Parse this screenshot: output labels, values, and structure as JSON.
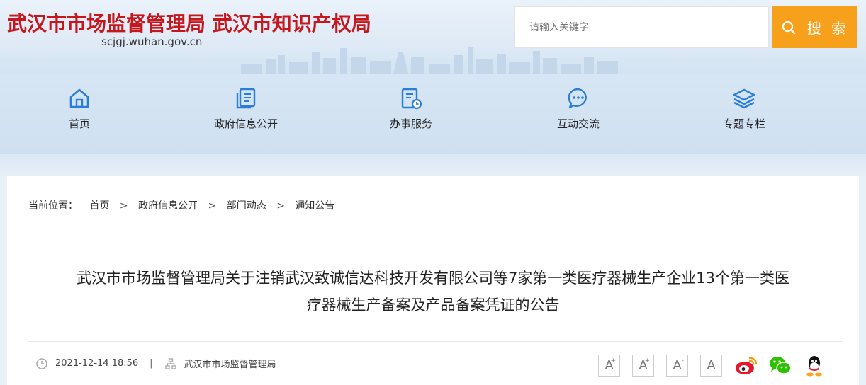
{
  "header": {
    "title": "武汉市市场监督管理局 武汉市知识产权局",
    "domain": "scjgj.wuhan.gov.cn",
    "search_placeholder": "请输入关键字",
    "search_button": "搜 索"
  },
  "nav": {
    "items": [
      {
        "label": "首页",
        "icon": "home-icon"
      },
      {
        "label": "政府信息公开",
        "icon": "document-icon"
      },
      {
        "label": "办事服务",
        "icon": "service-icon"
      },
      {
        "label": "互动交流",
        "icon": "chat-icon"
      },
      {
        "label": "专题专栏",
        "icon": "layers-icon"
      }
    ]
  },
  "breadcrumb": {
    "label": "当前位置：",
    "items": [
      "首页",
      "政府信息公开",
      "部门动态",
      "通知公告"
    ],
    "separator": ">"
  },
  "article": {
    "title_line1": "武汉市市场监督管理局关于注销武汉致诚信达科技开发有限公司等7家第一类医疗器械生产企业13个第一类医",
    "title_line2": "疗器械生产备案及产品备案凭证的公告",
    "date": "2021-12-14 18:56",
    "source": "武汉市市场监督管理局"
  },
  "tools": {
    "font_large": "A",
    "font_medium": "A",
    "font_small": "A",
    "font_reset": "A",
    "share_icons": [
      "weibo-icon",
      "wechat-icon",
      "qq-icon"
    ]
  },
  "colors": {
    "brand_red": "#c8161d",
    "search_orange": "#f7a01c",
    "nav_icon_blue": "#2a7fd4"
  }
}
